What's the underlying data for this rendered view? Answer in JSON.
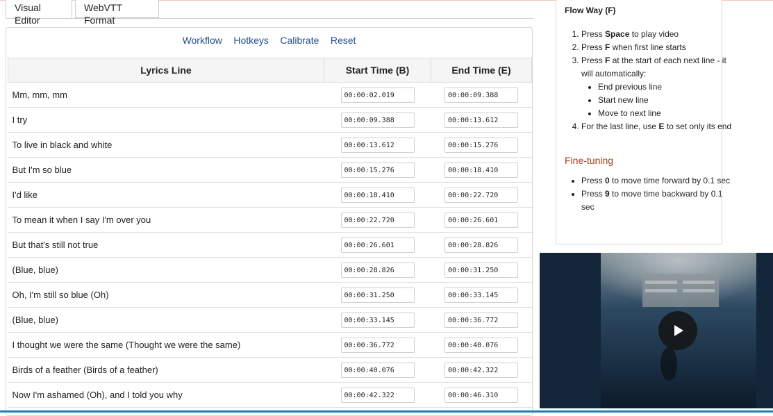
{
  "tabs": [
    {
      "label": "Visual Editor",
      "active": true
    },
    {
      "label": "WebVTT Format",
      "active": false
    }
  ],
  "toolbar": {
    "workflow": "Workflow",
    "hotkeys": "Hotkeys",
    "calibrate": "Calibrate",
    "reset": "Reset"
  },
  "table": {
    "headers": [
      "Lyrics Line",
      "Start Time (B)",
      "End Time (E)"
    ],
    "rows": [
      {
        "line": "Mm, mm, mm",
        "start": "00:00:02.019",
        "end": "00:00:09.388"
      },
      {
        "line": "I try",
        "start": "00:00:09.388",
        "end": "00:00:13.612"
      },
      {
        "line": "To live in black and white",
        "start": "00:00:13.612",
        "end": "00:00:15.276"
      },
      {
        "line": "But I'm so blue",
        "start": "00:00:15.276",
        "end": "00:00:18.410"
      },
      {
        "line": "I'd like",
        "start": "00:00:18.410",
        "end": "00:00:22.720"
      },
      {
        "line": "To mean it when I say I'm over you",
        "start": "00:00:22.720",
        "end": "00:00:26.601"
      },
      {
        "line": "But that's still not true",
        "start": "00:00:26.601",
        "end": "00:00:28.826"
      },
      {
        "line": "(Blue, blue)",
        "start": "00:00:28.826",
        "end": "00:00:31.250"
      },
      {
        "line": "Oh, I'm still so blue (Oh)",
        "start": "00:00:31.250",
        "end": "00:00:33.145"
      },
      {
        "line": "(Blue, blue)",
        "start": "00:00:33.145",
        "end": "00:00:36.772"
      },
      {
        "line": "I thought we were the same (Thought we were the same)",
        "start": "00:00:36.772",
        "end": "00:00:40.076"
      },
      {
        "line": "Birds of a feather (Birds of a feather)",
        "start": "00:00:40.076",
        "end": "00:00:42.322"
      },
      {
        "line": "Now I'm ashamed (Oh), and I told you why",
        "start": "00:00:42.322",
        "end": "00:00:46.310"
      }
    ]
  },
  "help": {
    "title": "Flow Way (F)",
    "step1_pre": "Press ",
    "step1_key": "Space",
    "step1_post": " to play video",
    "step2_pre": "Press ",
    "step2_key": "F",
    "step2_post": " when first line starts",
    "step3_pre": "Press ",
    "step3_key": "F",
    "step3_post": " at the start of each next line - it will automatically:",
    "sub": [
      "End previous line",
      "Start new line",
      "Move to next line"
    ],
    "step4_pre": "For the last line, use ",
    "step4_key": "E",
    "step4_post": " to set only its end",
    "finetune_title": "Fine-tuning",
    "tune1_pre": "Press ",
    "tune1_key": "0",
    "tune1_post": " to move time forward by 0.1 sec",
    "tune2_pre": "Press ",
    "tune2_key": "9",
    "tune2_post": " to move time backward by 0.1 sec"
  },
  "video": {
    "play_icon": "play-icon"
  }
}
